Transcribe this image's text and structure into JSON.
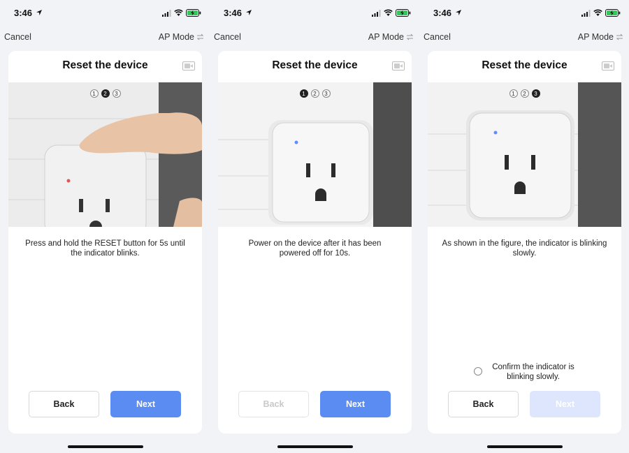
{
  "status_bar": {
    "time": "3:46"
  },
  "nav": {
    "cancel": "Cancel",
    "ap_mode": "AP Mode"
  },
  "screens": [
    {
      "title": "Reset the device",
      "steps": [
        "1",
        "2",
        "3"
      ],
      "active_step": 2,
      "description": "Press and hold the RESET button for 5s until the indicator blinks.",
      "back_label": "Back",
      "next_label": "Next",
      "back_enabled": true,
      "next_enabled": true
    },
    {
      "title": "Reset the device",
      "steps": [
        "1",
        "2",
        "3"
      ],
      "active_step": 1,
      "description": "Power on the device after it has been powered off for 10s.",
      "back_label": "Back",
      "next_label": "Next",
      "back_enabled": false,
      "next_enabled": true
    },
    {
      "title": "Reset the device",
      "steps": [
        "1",
        "2",
        "3"
      ],
      "active_step": 3,
      "description": "As shown in the figure, the indicator is blinking slowly.",
      "confirm_label": "Confirm the indicator is blinking slowly.",
      "back_label": "Back",
      "next_label": "Next",
      "back_enabled": true,
      "next_enabled": false
    }
  ],
  "colors": {
    "accent": "#5b8cf2",
    "accent_disabled": "#dde6fc",
    "background": "#f2f3f6"
  }
}
